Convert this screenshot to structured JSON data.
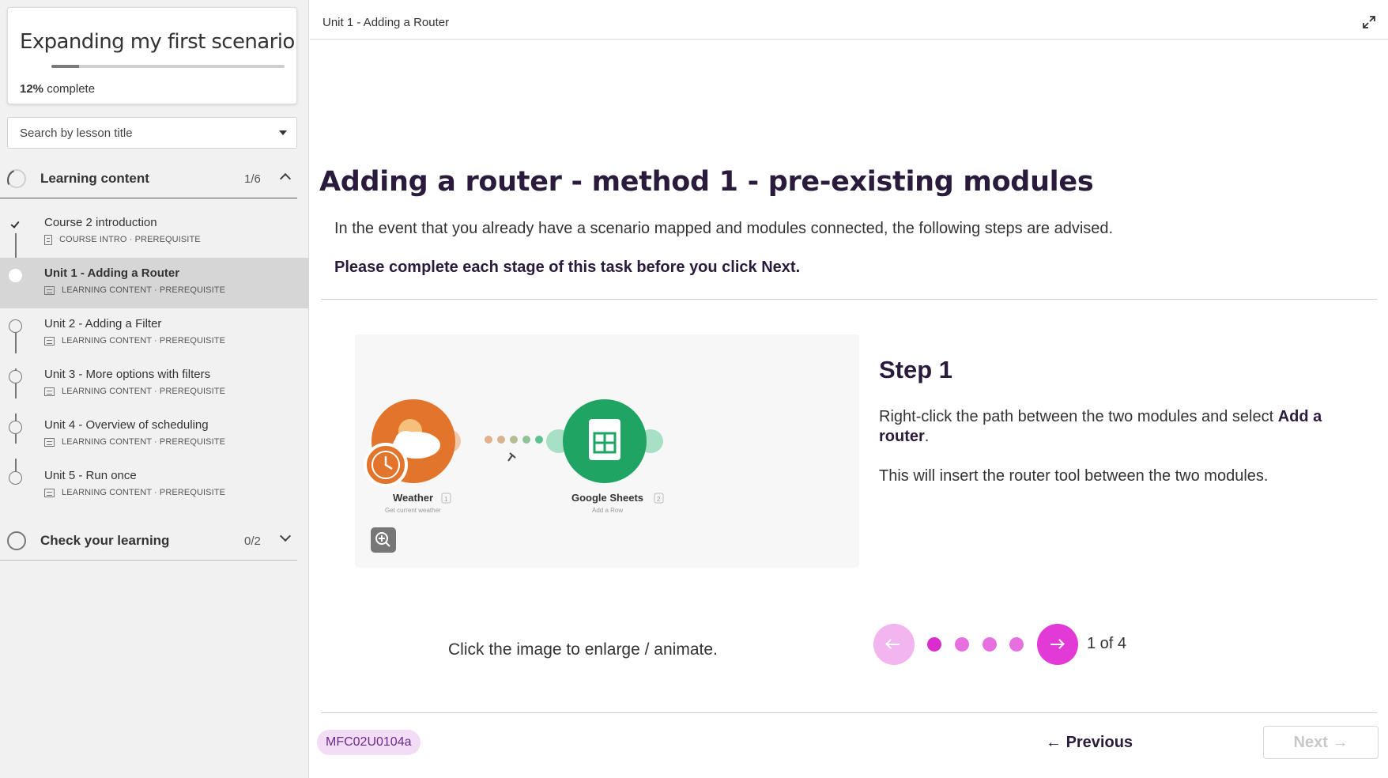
{
  "sidebar": {
    "course": {
      "title": "Expanding my first scenario",
      "progress_percent_label": "12%",
      "progress_suffix": "complete",
      "progress_value": 12
    },
    "search": {
      "placeholder": "Search by lesson title"
    },
    "sections": [
      {
        "title": "Learning content",
        "count": "1/6",
        "expanded": true,
        "lessons": [
          {
            "title": "Course 2 introduction",
            "meta": "Course intro · Prerequisite",
            "status": "completed",
            "icon": "document-icon"
          },
          {
            "title": "Unit 1 - Adding a Router",
            "meta": "Learning content · Prerequisite",
            "status": "current",
            "icon": "slides-icon"
          },
          {
            "title": "Unit 2 - Adding a Filter",
            "meta": "Learning content · Prerequisite",
            "status": "not-started",
            "icon": "slides-icon"
          },
          {
            "title": "Unit 3 - More options with filters",
            "meta": "Learning content · Prerequisite",
            "status": "not-started",
            "icon": "slides-icon"
          },
          {
            "title": "Unit 4 - Overview of scheduling",
            "meta": "Learning content · Prerequisite",
            "status": "not-started",
            "icon": "slides-icon"
          },
          {
            "title": "Unit 5 - Run once",
            "meta": "Learning content · Prerequisite",
            "status": "not-started",
            "icon": "slides-icon"
          }
        ]
      },
      {
        "title": "Check your learning",
        "count": "0/2",
        "expanded": false
      }
    ]
  },
  "header": {
    "title": "Unit 1 - Adding a Router",
    "expand_icon": "expand-icon"
  },
  "content": {
    "heading": "Adding a router - method 1 - pre-existing modules",
    "intro": "In the event that you already have a scenario mapped and modules connected, the following steps are advised.",
    "instruction": "Please complete each stage of this task before you click Next.",
    "figure": {
      "module_a": {
        "name": "Weather",
        "badge": "1",
        "subtitle": "Get current weather",
        "color": "#e2752b"
      },
      "module_b": {
        "name": "Google Sheets",
        "badge": "2",
        "subtitle": "Add a Row",
        "color": "#1fa463"
      },
      "zoom_icon": "zoom-in-icon"
    },
    "step": {
      "title": "Step 1",
      "text_before": "Right-click the path between the two modules and select ",
      "text_bold": "Add a router",
      "text_after": ".",
      "text2": "This will insert the router tool between the two modules."
    },
    "caption": "Click the image to enlarge / animate.",
    "pager": {
      "current": 1,
      "total": 4,
      "label": "1 of 4"
    }
  },
  "footer": {
    "code": "MFC02U0104a",
    "previous_label": "Previous",
    "next_label": "Next",
    "next_disabled": true
  },
  "colors": {
    "heading": "#2a1b3d",
    "accent": "#e23ad6",
    "accent_light": "#f2b5ef",
    "badge_bg": "#f3dcf6"
  }
}
